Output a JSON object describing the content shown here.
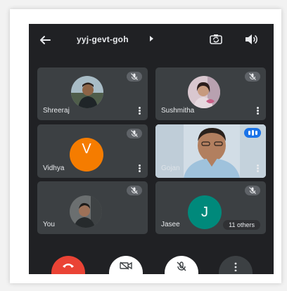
{
  "meeting": {
    "code": "yyj-gevt-goh"
  },
  "participants": [
    {
      "name": "Shreeraj",
      "muted": true,
      "avatar": "photo"
    },
    {
      "name": "Sushmitha",
      "muted": true,
      "avatar": "photo"
    },
    {
      "name": "Vidhya",
      "muted": true,
      "avatar": "letter",
      "initial": "V",
      "color": "#f57c00"
    },
    {
      "name": "Gojan",
      "muted": false,
      "speaking": true,
      "avatar": "video"
    },
    {
      "name": "You",
      "muted": true,
      "avatar": "photo"
    },
    {
      "name": "Jasee",
      "muted": true,
      "avatar": "letter",
      "initial": "J",
      "color": "#00897b"
    }
  ],
  "others_label": "11 others",
  "colors": {
    "background": "#202124",
    "tile": "#3c4043",
    "end_call": "#ea4335",
    "speaking_indicator": "#1a73e8"
  },
  "icons": {
    "back": "arrow-left-icon",
    "switch_camera": "switch-camera-icon",
    "audio_output": "speaker-icon",
    "mic_off": "mic-off-icon",
    "more": "more-vert-icon"
  }
}
